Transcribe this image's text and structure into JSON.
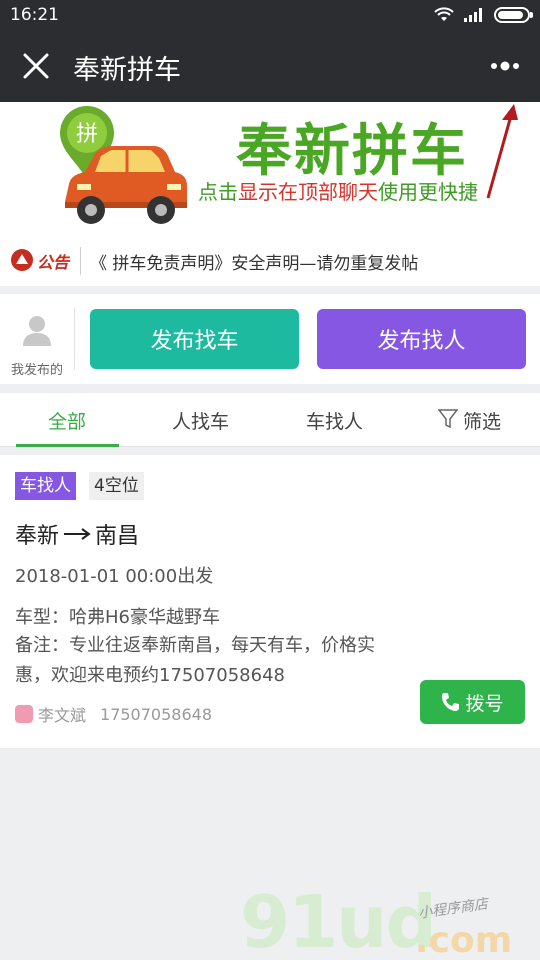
{
  "status_bar": {
    "time": "16:21",
    "battery_level": 0.9
  },
  "title_bar": {
    "title": "奉新拼车",
    "close_icon": "close-icon",
    "more_icon": "more-icon"
  },
  "banner": {
    "logo_badge": "拼",
    "logo_text": "奉新拼车",
    "subtitle_pre": "点击",
    "subtitle_highlight": "显示在顶部聊天",
    "subtitle_post": "使用更快捷"
  },
  "notice": {
    "tag": "公告",
    "text": "《 拼车免责声明》安全声明—请勿重复发帖"
  },
  "actions": {
    "my_posts_label": "我发布的",
    "find_car_label": "发布找车",
    "find_person_label": "发布找人",
    "colors": {
      "find_car": "#1ebaa0",
      "find_person": "#8657e3"
    }
  },
  "tabs": [
    {
      "label": "全部",
      "active": true
    },
    {
      "label": "人找车",
      "active": false
    },
    {
      "label": "车找人",
      "active": false
    },
    {
      "label": "筛选",
      "active": false,
      "icon": "filter-icon"
    }
  ],
  "listing": {
    "type_badge": "车找人",
    "seats_badge": "4空位",
    "origin": "奉新",
    "destination": "南昌",
    "depart": "2018-01-01 00:00出发",
    "car_model": "车型：哈弗H6豪华越野车",
    "remark": "备注：专业往返奉新南昌，每天有车，价格实惠，欢迎来电预约17507058648",
    "contact_name": "李文斌",
    "contact_phone": "17507058648",
    "call_label": "拨号"
  },
  "watermark": {
    "main": "91ud",
    "suffix": ".com",
    "tagline": "小程序商店"
  }
}
